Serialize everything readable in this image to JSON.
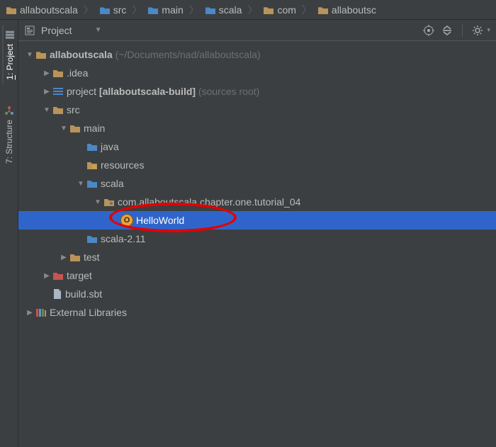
{
  "breadcrumb": [
    {
      "icon": "folder-tan",
      "label": "allaboutscala"
    },
    {
      "icon": "folder-blue",
      "label": "src"
    },
    {
      "icon": "folder-blue",
      "label": "main"
    },
    {
      "icon": "folder-blue",
      "label": "scala"
    },
    {
      "icon": "folder-tan",
      "label": "com"
    },
    {
      "icon": "folder-tan",
      "label": "allaboutsc"
    }
  ],
  "gutter": {
    "project": {
      "label": "1: Project",
      "underlined_idx": 3
    },
    "structure": {
      "label": "7: Structure"
    }
  },
  "panel": {
    "title": "Project"
  },
  "tree": {
    "root": {
      "name": "allaboutscala",
      "path": "(~/Documents/nad/allaboutscala)"
    },
    "idea": ".idea",
    "project_mod": {
      "pre": "project ",
      "bold": "[allaboutscala-build]",
      "post": " (sources root)"
    },
    "src": "src",
    "main": "main",
    "java": "java",
    "resources": "resources",
    "scala": "scala",
    "pkg": "com.allaboutscala.chapter.one.tutorial_04",
    "hello": "HelloWorld",
    "scala211": "scala-2.11",
    "test": "test",
    "target": "target",
    "build": "build.sbt",
    "external": "External Libraries"
  },
  "icons": {
    "obj_letter": "O"
  }
}
